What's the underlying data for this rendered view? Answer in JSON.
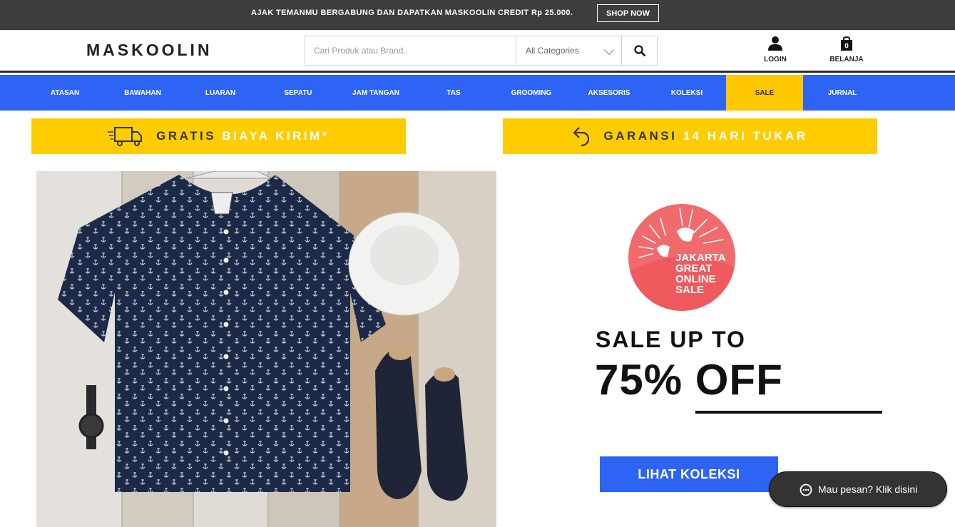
{
  "topbar": {
    "promo_text": "AJAK TEMANMU BERGABUNG DAN DAPATKAN MASKOOLIN CREDIT Rp 25.000.",
    "shop_now": "SHOP NOW"
  },
  "header": {
    "logo": "MASKOOLIN",
    "search_placeholder": "Cari Produk atau Brand..",
    "category_selected": "All Categories",
    "login_label": "LOGIN",
    "cart_label": "BELANJA",
    "cart_count": "0"
  },
  "nav": {
    "items": [
      "ATASAN",
      "BAWAHAN",
      "LUARAN",
      "SEPATU",
      "JAM TANGAN",
      "TAS",
      "GROOMING",
      "AKSESORIS",
      "KOLEKSI",
      "SALE",
      "JURNAL"
    ]
  },
  "banners": {
    "shipping_part1": "GRATIS",
    "shipping_part2": "BIAYA KIRIM*",
    "warranty_part1": "GARANSI",
    "warranty_part2": "14 HARI TUKAR"
  },
  "hero": {
    "badge_lines": [
      "JAKARTA",
      "GREAT",
      "ONLINE",
      "SALE"
    ],
    "headline": "SALE UP TO",
    "discount": "75% OFF",
    "cta": "LIHAT KOLEKSI"
  },
  "chat": {
    "label": "Mau pesan? Klik disini"
  },
  "colors": {
    "nav_blue": "#2e64f5",
    "accent_yellow": "#ffcc00",
    "badge_red": "#f16a6c",
    "topbar_dark": "#3d3d3d"
  }
}
